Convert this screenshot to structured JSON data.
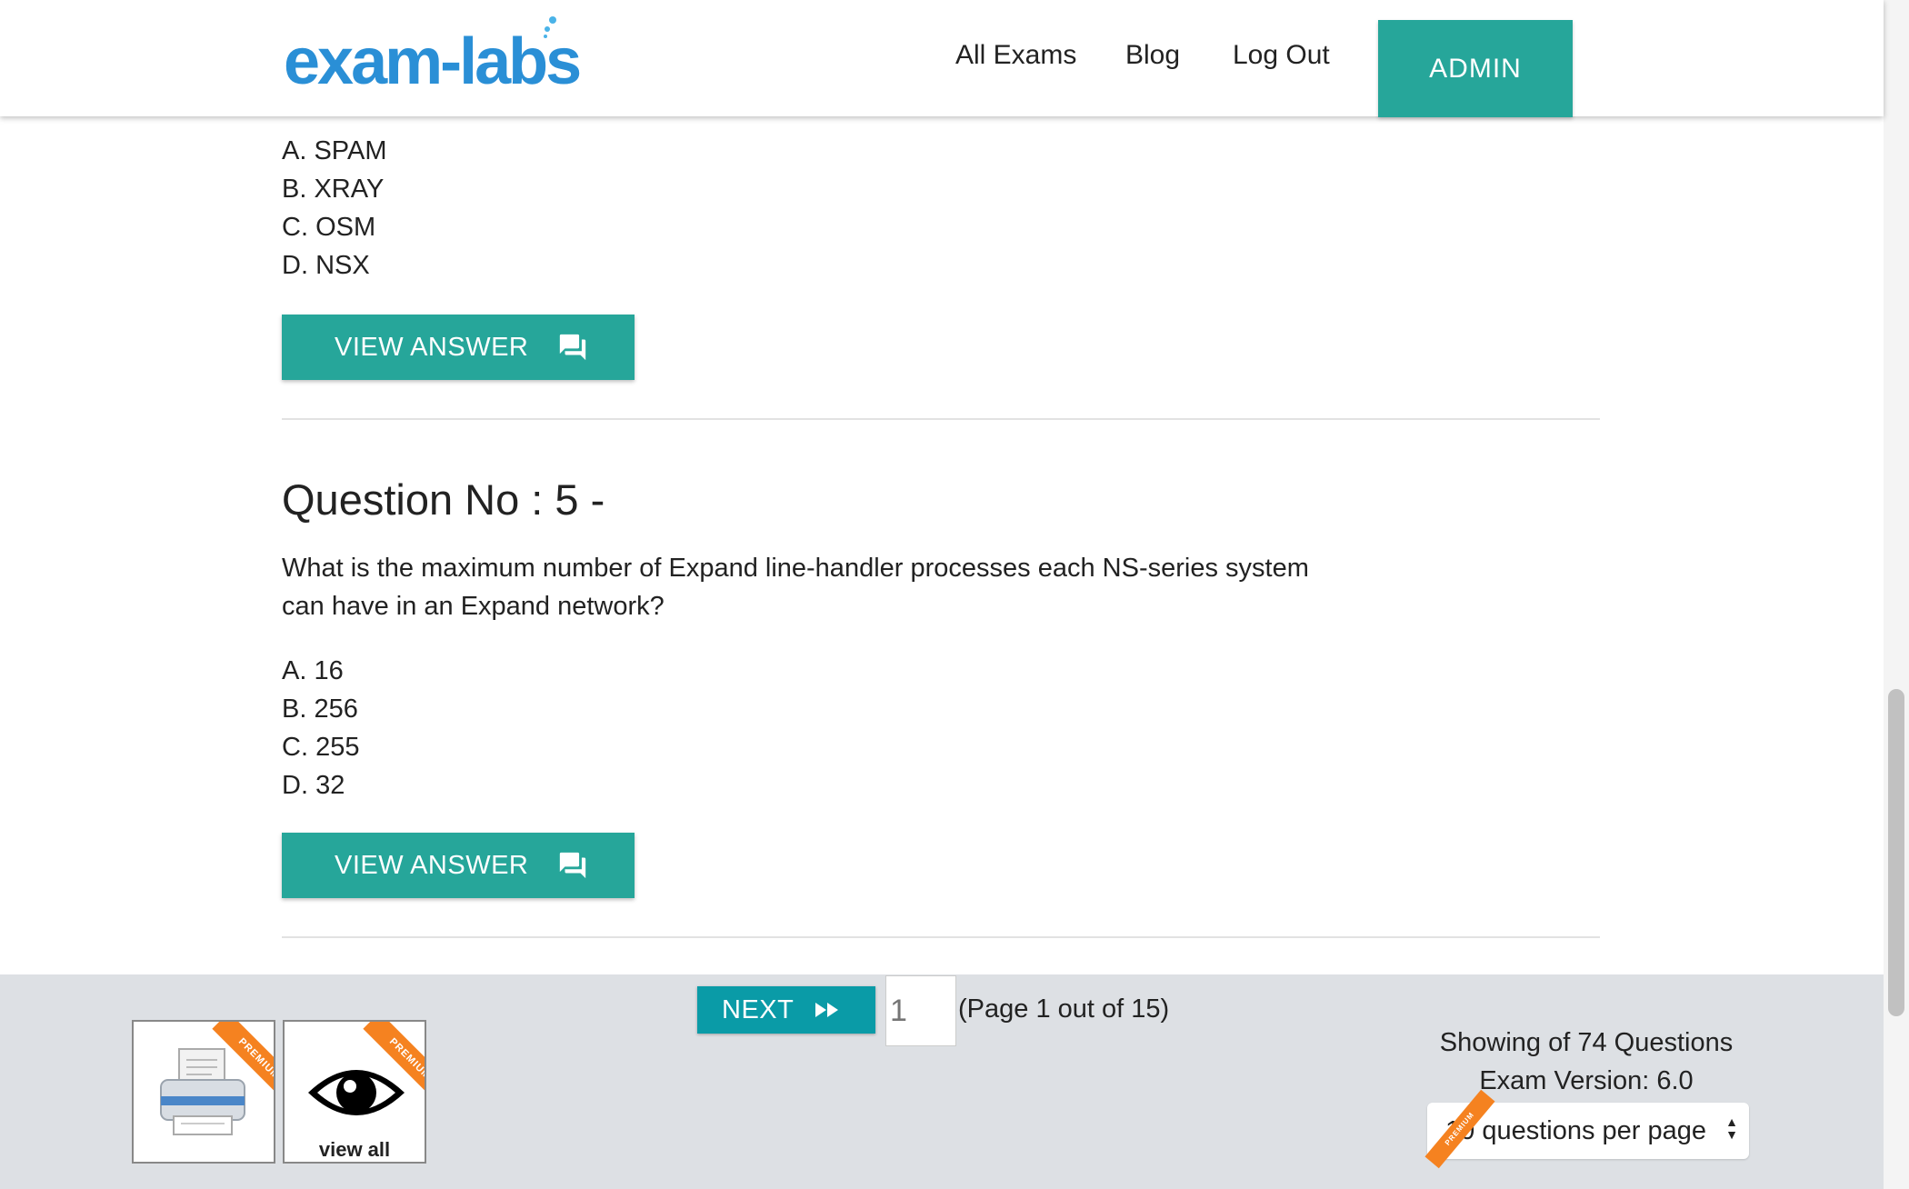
{
  "header": {
    "logo_text": "exam-labs",
    "nav": [
      "All Exams",
      "Blog",
      "Log Out"
    ],
    "admin_label": "ADMIN"
  },
  "question4": {
    "options": [
      {
        "letter": "A.",
        "text": "SPAM"
      },
      {
        "letter": "B.",
        "text": "XRAY"
      },
      {
        "letter": "C.",
        "text": "OSM"
      },
      {
        "letter": "D.",
        "text": "NSX"
      }
    ],
    "view_answer_label": "VIEW ANSWER"
  },
  "question5": {
    "title": "Question No : 5 -",
    "text": "What is the maximum number of Expand line-handler processes each NS-series system can have in an Expand network?",
    "options": [
      {
        "letter": "A.",
        "text": "16"
      },
      {
        "letter": "B.",
        "text": "256"
      },
      {
        "letter": "C.",
        "text": "255"
      },
      {
        "letter": "D.",
        "text": "32"
      }
    ],
    "view_answer_label": "VIEW ANSWER"
  },
  "footer": {
    "next_label": "NEXT",
    "page_input_placeholder": "1",
    "page_info": "(Page 1 out of 15)",
    "premium_label": "PREMIUM",
    "view_all_label": "view all",
    "showing": "Showing of 74 Questions",
    "exam_version": "Exam Version: 6.0",
    "per_page": "10 questions per page"
  },
  "icons": {
    "answer": "chat-bubble-icon",
    "next": "fast-forward-icon",
    "print": "printer-icon",
    "view_all": "eye-icon"
  },
  "colors": {
    "accent": "#26a69a",
    "next": "#0a9ba7",
    "premium": "#f58220",
    "footer_bg": "#dde0e4",
    "logo": "#2a8fd6"
  }
}
